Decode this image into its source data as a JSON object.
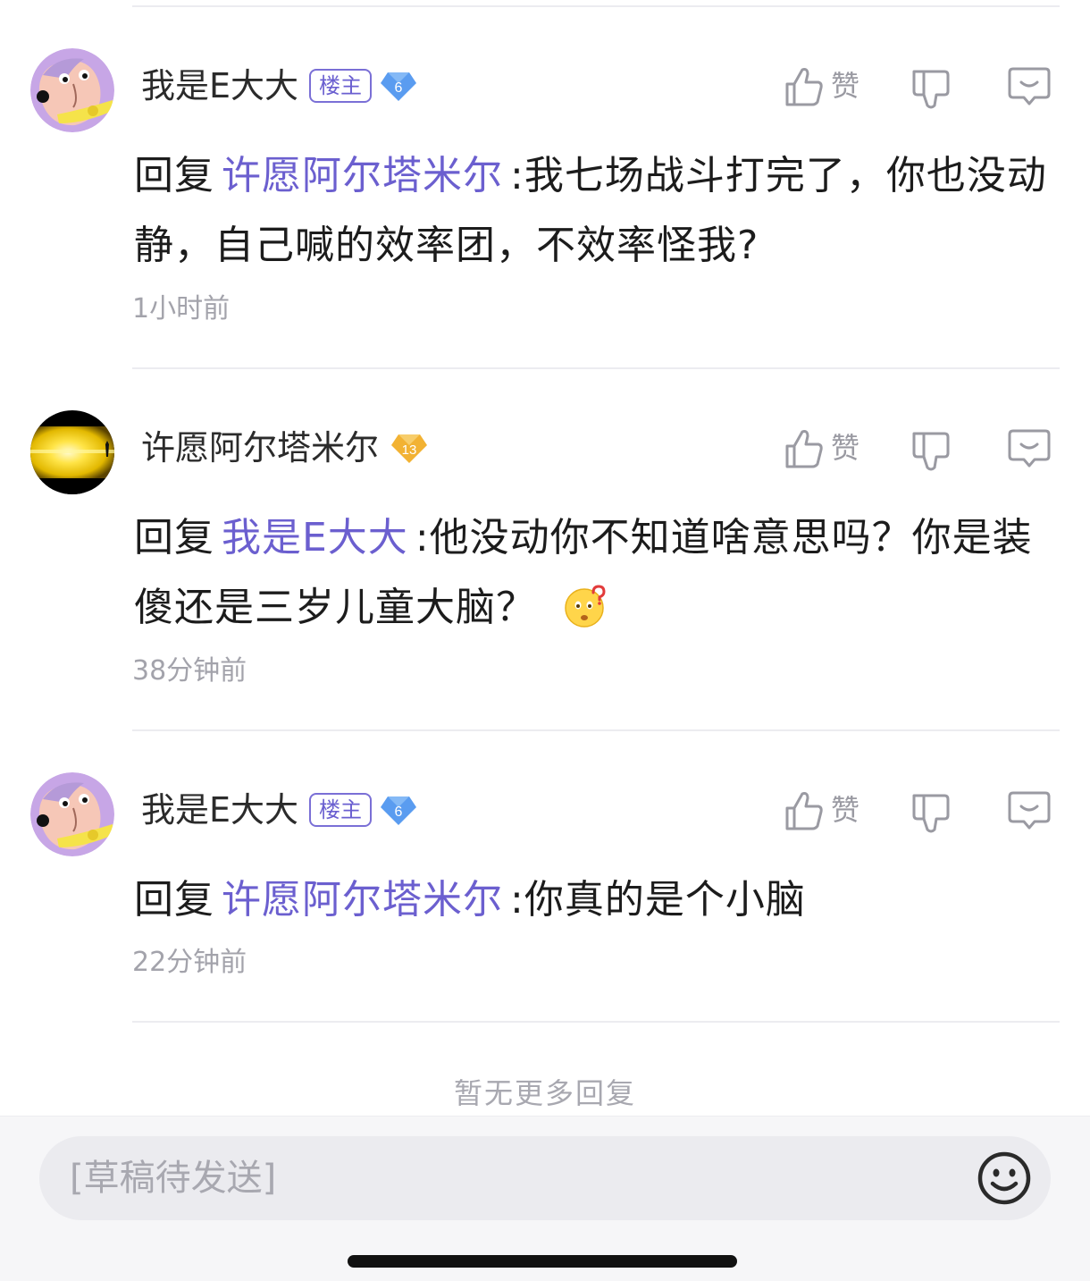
{
  "replies": [
    {
      "username": "我是E大大",
      "op_badge": "楼主",
      "level": "6",
      "like_label": "赞",
      "reply_prefix": "回复",
      "mention": "许愿阿尔塔米尔",
      "text": ":我七场战斗打完了，你也没动静，自己喊的效率团，不效率怪我?",
      "time": "1小时前"
    },
    {
      "username": "许愿阿尔塔米尔",
      "level": "13",
      "like_label": "赞",
      "reply_prefix": "回复",
      "mention": "我是E大大",
      "text": ":他没动你不知道啥意思吗？你是装傻还是三岁儿童大脑？",
      "emoji": "thinking-face-emoji",
      "time": "38分钟前"
    },
    {
      "username": "我是E大大",
      "op_badge": "楼主",
      "level": "6",
      "like_label": "赞",
      "reply_prefix": "回复",
      "mention": "许愿阿尔塔米尔",
      "text": ":你真的是个小脑",
      "time": "22分钟前"
    }
  ],
  "footer": {
    "no_more": "暂无更多回复"
  },
  "composer": {
    "draft_placeholder": "[草稿待发送]",
    "emoji_button": "smile-icon"
  },
  "colors": {
    "mention": "#6b5fcf",
    "op_badge": "#7a6fd6",
    "level_6": "#5a9cf0",
    "level_13": "#f2b233",
    "muted": "#a3a3ab"
  }
}
